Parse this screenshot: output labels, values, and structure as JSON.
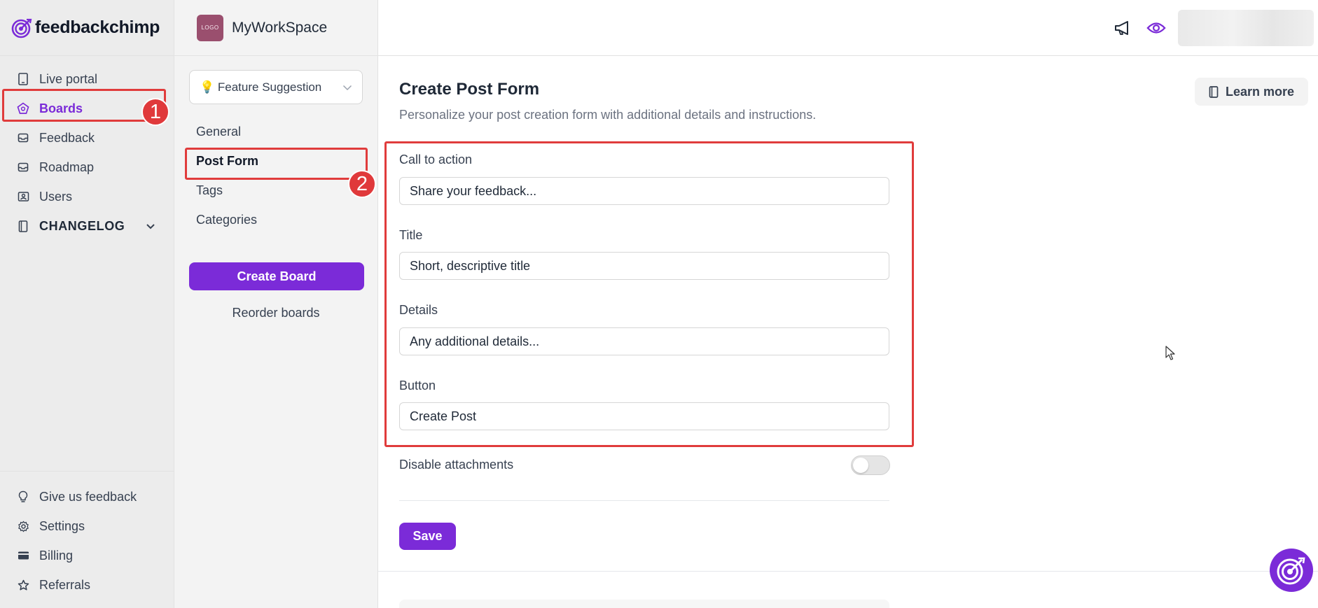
{
  "brand": {
    "name": "feedbackchimp"
  },
  "sidebar": {
    "items": [
      {
        "label": "Live portal",
        "icon": "tablet-icon"
      },
      {
        "label": "Boards",
        "icon": "boards-icon",
        "active": true
      },
      {
        "label": "Feedback",
        "icon": "inbox-icon"
      },
      {
        "label": "Roadmap",
        "icon": "roadmap-icon"
      },
      {
        "label": "Users",
        "icon": "users-icon"
      },
      {
        "label": "CHANGELOG",
        "icon": "book-icon"
      }
    ],
    "bottom_items": [
      {
        "label": "Give us feedback",
        "icon": "lightbulb-icon"
      },
      {
        "label": "Settings",
        "icon": "gear-icon"
      },
      {
        "label": "Billing",
        "icon": "credit-card-icon"
      },
      {
        "label": "Referrals",
        "icon": "star-icon"
      }
    ]
  },
  "workspace": {
    "logo_text": "LOGO",
    "name": "MyWorkSpace"
  },
  "board_select": {
    "value": "💡 Feature Suggestion"
  },
  "sub_nav": {
    "items": [
      {
        "label": "General"
      },
      {
        "label": "Post Form",
        "active": true
      },
      {
        "label": "Tags"
      },
      {
        "label": "Categories"
      }
    ],
    "create_board": "Create Board",
    "reorder": "Reorder boards"
  },
  "main": {
    "title": "Create Post Form",
    "subtitle": "Personalize your post creation form with additional details and instructions.",
    "learn_more": "Learn more",
    "fields": [
      {
        "label": "Call to action",
        "value": "Share your feedback..."
      },
      {
        "label": "Title",
        "value": "Short, descriptive title"
      },
      {
        "label": "Details",
        "value": "Any additional details..."
      },
      {
        "label": "Button",
        "value": "Create Post"
      }
    ],
    "disable_attachments": {
      "label": "Disable attachments",
      "enabled": false
    },
    "save": "Save"
  },
  "annotations": {
    "step1": "1",
    "step2": "2"
  },
  "colors": {
    "accent": "#7b2bd8",
    "annotation": "#e03c3c"
  }
}
